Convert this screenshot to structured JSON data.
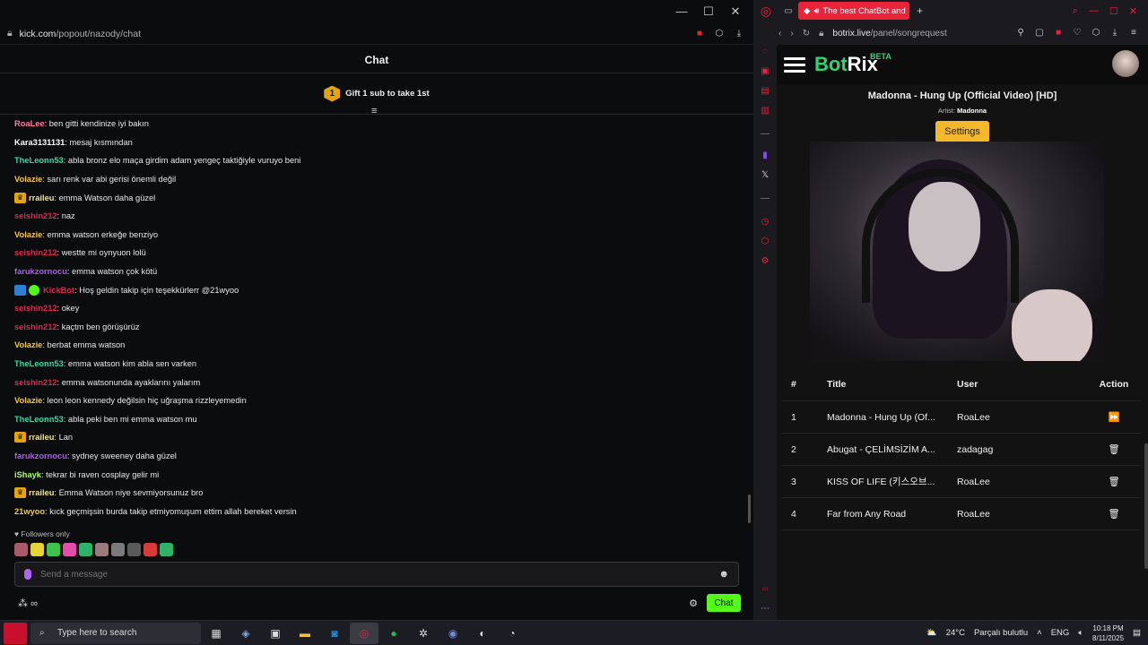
{
  "left_window": {
    "url_domain": "kick.com",
    "url_path": "/popout/nazody/chat",
    "chat_title": "Chat",
    "gift_badge": "1",
    "gift_text": "Gift 1 sub to take 1st",
    "messages": [
      {
        "user": "RoaLee",
        "color": "#ff7aa2",
        "text": ": ben gitti kendinize iyi bakın",
        "badge": ""
      },
      {
        "user": "Kara3131131",
        "color": "#ffffff",
        "text": ": mesaj kısmından",
        "badge": ""
      },
      {
        "user": "TheLeonn53",
        "color": "#37d7a7",
        "text": ": abla bronz elo maça girdim adam yengeç taktiğiyle vuruyo beni",
        "badge": ""
      },
      {
        "user": "Volazie",
        "color": "#f6c744",
        "text": ": sarı renk var abi gerisi önemli değil",
        "badge": ""
      },
      {
        "user": "rraileu",
        "color": "#f0e68c",
        "text": ": emma Watson daha güzel",
        "badge": "crown"
      },
      {
        "user": "seishin212",
        "color": "#e0264f",
        "text": ": naz",
        "badge": ""
      },
      {
        "user": "Volazie",
        "color": "#f6c744",
        "text": ": emma watson erkeğe benziyo",
        "badge": ""
      },
      {
        "user": "seishin212",
        "color": "#e0264f",
        "text": ": westte mi oynyuon lolü",
        "badge": ""
      },
      {
        "user": "farukzornocu",
        "color": "#b05cf4",
        "text": ": emma watson çok kötü",
        "badge": ""
      },
      {
        "user": "KickBot",
        "color": "#e0264f",
        "text": ": Hoş geldin takip için teşekkürlerr @21wyoo",
        "badge": "bot"
      },
      {
        "user": "seishin212",
        "color": "#e0264f",
        "text": ": okey",
        "badge": ""
      },
      {
        "user": "seishin212",
        "color": "#e0264f",
        "text": ": kaçtm ben görüşürüz",
        "badge": ""
      },
      {
        "user": "Volazie",
        "color": "#f6c744",
        "text": ": berbat emma watson",
        "badge": ""
      },
      {
        "user": "TheLeonn53",
        "color": "#37d7a7",
        "text": ": emma watson kim abla sen varken",
        "badge": ""
      },
      {
        "user": "seishin212",
        "color": "#e0264f",
        "text": ": emma watsonunda ayaklarını yalarım",
        "badge": ""
      },
      {
        "user": "Volazie",
        "color": "#f6c744",
        "text": ": leon leon kennedy değilsin hiç uğraşma rizzleyemedin",
        "badge": ""
      },
      {
        "user": "TheLeonn53",
        "color": "#37d7a7",
        "text": ": abla peki ben mi emma watson mu",
        "badge": ""
      },
      {
        "user": "rraileu",
        "color": "#f0e68c",
        "text": ": Lan",
        "badge": "crown"
      },
      {
        "user": "farukzornocu",
        "color": "#b05cf4",
        "text": ": sydney sweeney daha güzel",
        "badge": ""
      },
      {
        "user": "iShayk",
        "color": "#a8ff60",
        "text": ": tekrar bi raven cosplay gelir mi",
        "badge": ""
      },
      {
        "user": "rraileu",
        "color": "#f0e68c",
        "text": ": Emma Watson niye sevmiyorsunuz bro",
        "badge": "crown"
      },
      {
        "user": "21wyoo",
        "color": "#f6c744",
        "text": ": kıck geçmişsin burda takip etmiyomuşum ettim allah bereket versin",
        "badge": ""
      }
    ],
    "followers_only": "Followers only",
    "input_placeholder": "Send a message",
    "points_label": "∞",
    "chat_button": "Chat"
  },
  "right_window": {
    "tab_title": "The best ChatBot and",
    "url_domain": "botrix.live",
    "url_path": "/panel/songrequest",
    "brand_bot": "Bot",
    "brand_rix": "Rix",
    "beta": "BETA",
    "song_title": "Madonna - Hung Up (Official Video) [HD]",
    "artist_label": "Artist:",
    "artist": "Madonna",
    "settings_button": "Settings",
    "table_headers": [
      "#",
      "Title",
      "User",
      "Action"
    ],
    "rows": [
      {
        "n": "1",
        "title": "Madonna - Hung Up (Of...",
        "user": "RoaLee",
        "action": "play"
      },
      {
        "n": "2",
        "title": "Abugat - ÇELİMSİZİM A...",
        "user": "zadagag",
        "action": "delete"
      },
      {
        "n": "3",
        "title": "KISS OF LIFE (키스오브...",
        "user": "RoaLee",
        "action": "delete"
      },
      {
        "n": "4",
        "title": "Far from Any Road",
        "user": "RoaLee",
        "action": "delete"
      }
    ]
  },
  "taskbar": {
    "search_placeholder": "Type here to search",
    "temperature": "24°C",
    "weather": "Parçalı bulutlu",
    "language": "ENG",
    "time": "10:18 PM",
    "date": "8/11/2025"
  },
  "colors": {
    "kick_green": "#53fc18",
    "botrix_green": "#2ed573",
    "opera_red": "#e8233a",
    "settings_yellow": "#f6b82b"
  }
}
